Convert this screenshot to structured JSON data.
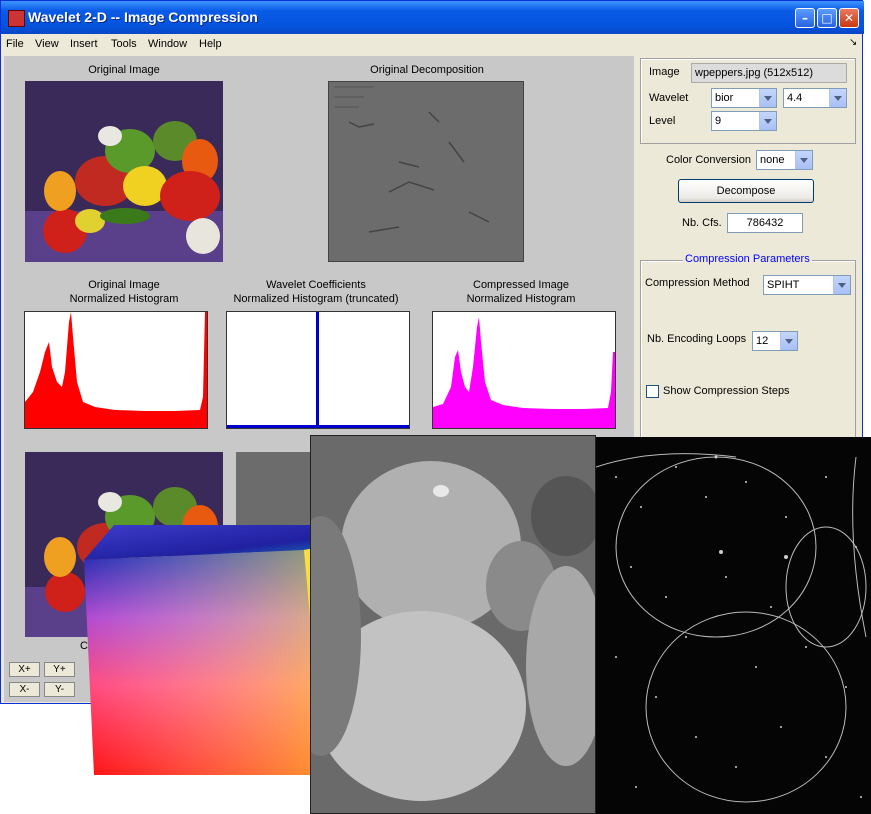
{
  "window": {
    "title": "Wavelet 2-D -- Image Compression"
  },
  "menu": [
    "File",
    "View",
    "Insert",
    "Tools",
    "Window",
    "Help"
  ],
  "figure": {
    "original_image_title": "Original Image",
    "original_decomp_title": "Original Decomposition",
    "hist1_title": "Original Image",
    "hist1_subtitle": "Normalized Histogram",
    "hist2_title": "Wavelet Coefficients",
    "hist2_subtitle": "Normalized Histogram (truncated)",
    "hist3_title": "Compressed Image",
    "hist3_subtitle": "Normalized Histogram",
    "bottom_label_fragment": "C",
    "axis_buttons": [
      "X+",
      "Y+",
      "X-",
      "Y-"
    ]
  },
  "panel": {
    "image_label": "Image",
    "image_value": "wpeppers.jpg  (512x512)",
    "wavelet_label": "Wavelet",
    "wavelet_family": "bior",
    "wavelet_number": "4.4",
    "level_label": "Level",
    "level_value": "9",
    "color_conv_label": "Color Conversion",
    "color_conv_value": "none",
    "decompose_label": "Decompose",
    "nbcfs_label": "Nb. Cfs.",
    "nbcfs_value": "786432",
    "comp_params_title": "Compression Parameters",
    "comp_method_label": "Compression Method",
    "comp_method_value": "SPIHT",
    "enc_loops_label": "Nb. Encoding Loops",
    "enc_loops_value": "12",
    "show_steps_label": "Show Compression Steps"
  },
  "colors": {
    "title_bar": "#0a5be6",
    "hist_original": "#ff0000",
    "hist_wavelet": "#0000cc",
    "hist_compressed": "#ff00ff",
    "param_title": "#0000ff"
  }
}
